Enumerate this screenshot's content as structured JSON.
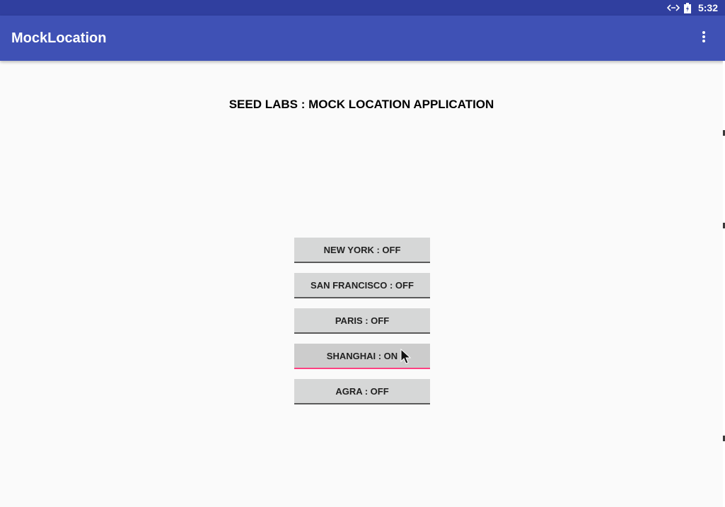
{
  "status_bar": {
    "time": "5:32",
    "icons": [
      "data-transfer-icon",
      "battery-charging-icon"
    ]
  },
  "app_bar": {
    "title": "MockLocation",
    "menu_icon": "more-vert-icon"
  },
  "main": {
    "header": "SEED LABS : MOCK LOCATION APPLICATION",
    "buttons": [
      {
        "label": "NEW YORK : OFF",
        "active": false
      },
      {
        "label": "SAN FRANCISCO : OFF",
        "active": false
      },
      {
        "label": "PARIS : OFF",
        "active": false
      },
      {
        "label": "SHANGHAI : ON",
        "active": true
      },
      {
        "label": "AGRA : OFF",
        "active": false
      }
    ]
  },
  "colors": {
    "status_bar": "#303f9f",
    "app_bar": "#3f51b5",
    "background": "#fafafa",
    "button": "#d6d7d7",
    "accent": "#ff4081"
  }
}
